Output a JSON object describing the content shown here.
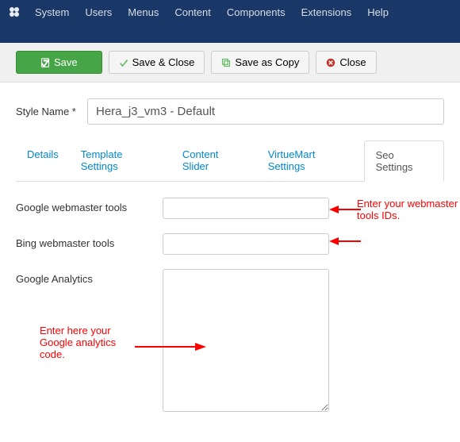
{
  "topMenu": {
    "items": [
      "System",
      "Users",
      "Menus",
      "Content",
      "Components",
      "Extensions",
      "Help"
    ]
  },
  "toolbar": {
    "save": "Save",
    "saveClose": "Save & Close",
    "saveCopy": "Save as Copy",
    "close": "Close"
  },
  "form": {
    "styleNameLabel": "Style Name *",
    "styleNameValue": "Hera_j3_vm3 - Default"
  },
  "tabs": [
    "Details",
    "Template Settings",
    "Content Slider",
    "VirtueMart Settings",
    "Seo Settings"
  ],
  "activeTab": 4,
  "fields": {
    "googleWebmaster": {
      "label": "Google webmaster tools",
      "value": ""
    },
    "bingWebmaster": {
      "label": "Bing webmaster tools",
      "value": ""
    },
    "googleAnalytics": {
      "label": "Google Analytics",
      "value": ""
    }
  },
  "annotations": {
    "webmaster": "Enter your webmaster tools IDs.",
    "analytics": "Enter here your Google analytics code."
  }
}
